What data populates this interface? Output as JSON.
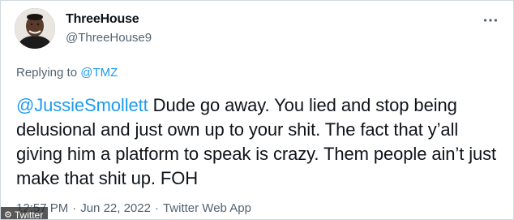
{
  "author": {
    "display_name": "ThreeHouse",
    "handle": "@ThreeHouse9",
    "avatar_icon": "profile-photo"
  },
  "reply": {
    "prefix": "Replying to ",
    "mention": "@TMZ"
  },
  "tweet": {
    "mention": "@JussieSmollett",
    "text": " Dude go away. You lied and stop being delusional and just own up to your shit. The fact that y’all giving him a platform to speak is crazy. Them people ain’t just make that shit up. FOH"
  },
  "meta": {
    "time": "12:57 PM",
    "separator": "·",
    "date": "Jun 22, 2022",
    "source": "Twitter Web App"
  },
  "credit": {
    "label": "Twitter"
  },
  "colors": {
    "link": "#1d9bf0",
    "secondary": "#536471",
    "text": "#0f1419"
  }
}
